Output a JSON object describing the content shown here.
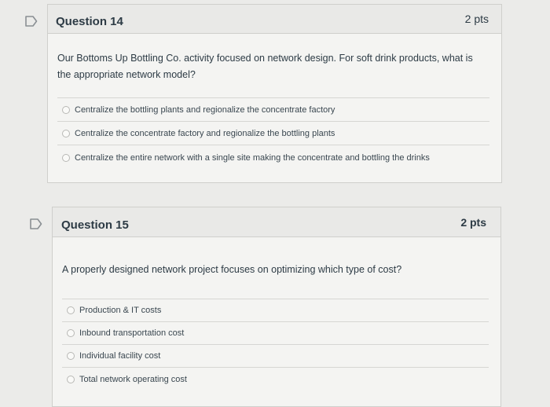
{
  "questions": [
    {
      "title": "Question 14",
      "points": "2 pts",
      "text": "Our Bottoms Up Bottling Co. activity focused on network design. For soft drink products, what is the appropriate network model?",
      "answers": [
        "Centralize the bottling plants and regionalize the concentrate factory",
        "Centralize the concentrate factory and regionalize the bottling plants",
        "Centralize the entire network with a single site making the concentrate and bottling the drinks"
      ]
    },
    {
      "title": "Question 15",
      "points": "2 pts",
      "text": "A properly designed network project focuses on optimizing which type of cost?",
      "answers": [
        "Production & IT costs",
        "Inbound transportation cost",
        "Individual facility cost",
        "Total network operating cost"
      ]
    }
  ],
  "icons": {
    "flag": "flag-question-icon",
    "radio": "radio-button-icon"
  },
  "colors": {
    "page_background": "#ebebe9",
    "card_background": "#f4f4f2",
    "header_background": "#e9e9e7",
    "text": "#2d3b45"
  }
}
